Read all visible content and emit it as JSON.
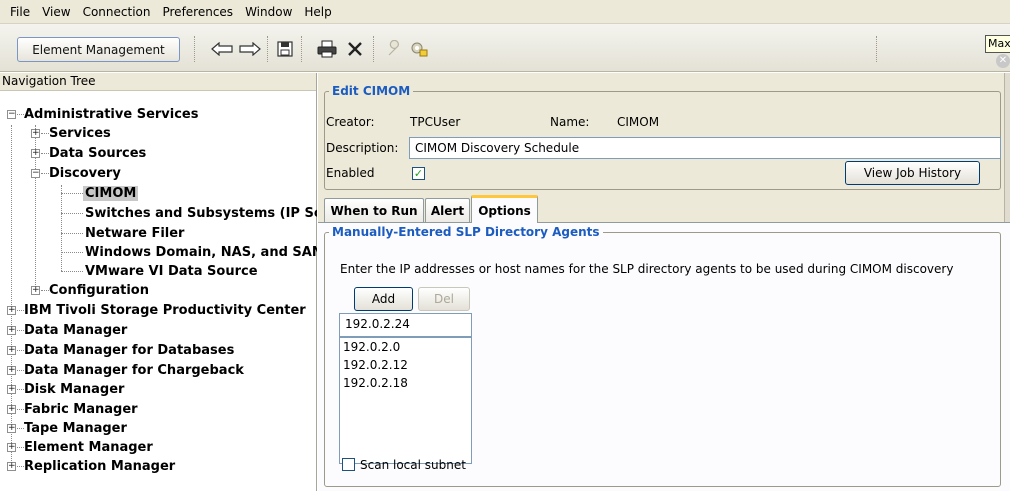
{
  "menu": [
    {
      "label": "File"
    },
    {
      "label": "View"
    },
    {
      "label": "Connection"
    },
    {
      "label": "Preferences"
    },
    {
      "label": "Window"
    },
    {
      "label": "Help"
    }
  ],
  "toolbar": {
    "element_management_label": "Element Management",
    "icons": [
      "back-arrow-icon",
      "forward-arrow-icon",
      "save-disk-icon",
      "print-icon",
      "delete-x-icon",
      "wrench-icon",
      "settings-gear-icon"
    ],
    "tooltip": "Max"
  },
  "nav": {
    "title": "Navigation Tree",
    "nodes": [
      {
        "label": "Administrative Services",
        "expanded": true
      },
      {
        "label": "Services",
        "expanded": false
      },
      {
        "label": "Data Sources",
        "expanded": false
      },
      {
        "label": "Discovery",
        "expanded": true
      },
      {
        "label": "CIMOM",
        "selected": true
      },
      {
        "label": "Switches and Subsystems (IP Sca"
      },
      {
        "label": "Netware Filer"
      },
      {
        "label": "Windows Domain, NAS, and SAN F"
      },
      {
        "label": "VMware VI Data Source"
      },
      {
        "label": "Configuration",
        "expanded": false
      },
      {
        "label": "IBM Tivoli Storage Productivity Center",
        "expanded": false
      },
      {
        "label": "Data Manager",
        "expanded": false
      },
      {
        "label": "Data Manager for Databases",
        "expanded": false
      },
      {
        "label": "Data Manager for Chargeback",
        "expanded": false
      },
      {
        "label": "Disk Manager",
        "expanded": false
      },
      {
        "label": "Fabric Manager",
        "expanded": false
      },
      {
        "label": "Tape Manager",
        "expanded": false
      },
      {
        "label": "Element Manager",
        "expanded": false
      },
      {
        "label": "Replication Manager",
        "expanded": false
      }
    ]
  },
  "edit": {
    "legend": "Edit CIMOM",
    "creator_label": "Creator:",
    "creator_value": "TPCUser",
    "name_label": "Name:",
    "name_value": "CIMOM",
    "description_label": "Description:",
    "description_value": "CIMOM Discovery Schedule",
    "enabled_label": "Enabled",
    "enabled": true,
    "view_history_label": "View Job History"
  },
  "tabs": [
    {
      "label": "When to Run",
      "active": false
    },
    {
      "label": "Alert",
      "active": false
    },
    {
      "label": "Options",
      "active": true
    }
  ],
  "slp": {
    "legend": "Manually-Entered SLP Directory Agents",
    "instructions": "Enter the IP addresses or host names for the SLP directory agents to be used during CIMOM discovery",
    "add_label": "Add",
    "del_label": "Del",
    "input_value": "192.0.2.24",
    "agents": [
      "192.0.2.0",
      "192.0.2.12",
      "192.0.2.18"
    ],
    "scan_label": "Scan local subnet",
    "scan_checked": false
  }
}
